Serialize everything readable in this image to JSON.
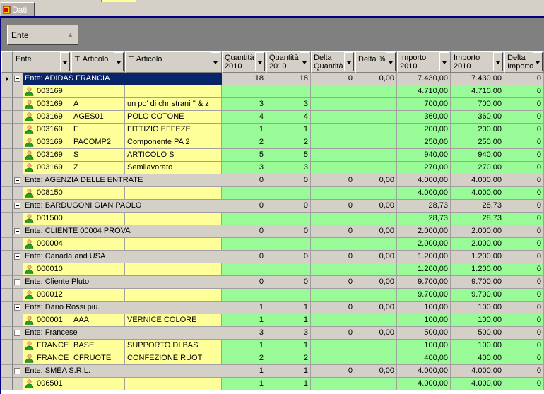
{
  "tab": {
    "label": "Dati"
  },
  "group_panel": {
    "label": "Ente"
  },
  "columns": {
    "ente": "Ente",
    "articolo1": "Articolo",
    "articolo2": "Articolo",
    "q2010a": "Quantità\n2010",
    "q2010b": "Quantità\n2010",
    "delta_q": "Delta\nQuantità",
    "delta_pct": "Delta %",
    "imp2010a": "Importo\n2010",
    "imp2010b": "Importo\n2010",
    "delta_imp": "Delta\nImporto"
  },
  "rows": [
    {
      "type": "group",
      "selected": true,
      "title": "Ente: ADIDAS FRANCIA",
      "v": [
        "18",
        "18",
        "0",
        "0,00",
        "7.430,00",
        "7.430,00",
        "0"
      ]
    },
    {
      "type": "detail",
      "c": [
        "003169",
        "",
        ""
      ],
      "v": [
        "",
        "",
        "",
        "",
        "4.710,00",
        "4.710,00",
        "0"
      ]
    },
    {
      "type": "detail",
      "c": [
        "003169",
        "A",
        "un po' di chr strani '' & z"
      ],
      "v": [
        "3",
        "3",
        "",
        "",
        "700,00",
        "700,00",
        "0"
      ]
    },
    {
      "type": "detail",
      "c": [
        "003169",
        "AGES01",
        "POLO COTONE"
      ],
      "v": [
        "4",
        "4",
        "",
        "",
        "360,00",
        "360,00",
        "0"
      ]
    },
    {
      "type": "detail",
      "c": [
        "003169",
        "F",
        "FITTIZIO EFFEZE"
      ],
      "v": [
        "1",
        "1",
        "",
        "",
        "200,00",
        "200,00",
        "0"
      ]
    },
    {
      "type": "detail",
      "c": [
        "003169",
        "PACOMP2",
        "Componente PA 2"
      ],
      "v": [
        "2",
        "2",
        "",
        "",
        "250,00",
        "250,00",
        "0"
      ]
    },
    {
      "type": "detail",
      "c": [
        "003169",
        "S",
        "ARTICOLO S"
      ],
      "v": [
        "5",
        "5",
        "",
        "",
        "940,00",
        "940,00",
        "0"
      ]
    },
    {
      "type": "detail",
      "c": [
        "003169",
        "Z",
        "Semilavorato"
      ],
      "v": [
        "3",
        "3",
        "",
        "",
        "270,00",
        "270,00",
        "0"
      ]
    },
    {
      "type": "group",
      "title": "Ente: AGENZIA DELLE ENTRATE",
      "v": [
        "0",
        "0",
        "0",
        "0,00",
        "4.000,00",
        "4.000,00",
        "0"
      ]
    },
    {
      "type": "detail",
      "c": [
        "008150",
        "",
        ""
      ],
      "v": [
        "",
        "",
        "",
        "",
        "4.000,00",
        "4.000,00",
        "0"
      ]
    },
    {
      "type": "group",
      "title": "Ente: BARDUGONI GIAN PAOLO",
      "v": [
        "0",
        "0",
        "0",
        "0,00",
        "28,73",
        "28,73",
        "0"
      ]
    },
    {
      "type": "detail",
      "c": [
        "001500",
        "",
        ""
      ],
      "v": [
        "",
        "",
        "",
        "",
        "28,73",
        "28,73",
        "0"
      ]
    },
    {
      "type": "group",
      "title": "Ente: CLIENTE 00004 PROVA",
      "v": [
        "0",
        "0",
        "0",
        "0,00",
        "2.000,00",
        "2.000,00",
        "0"
      ]
    },
    {
      "type": "detail",
      "c": [
        "000004",
        "",
        ""
      ],
      "v": [
        "",
        "",
        "",
        "",
        "2.000,00",
        "2.000,00",
        "0"
      ]
    },
    {
      "type": "group",
      "title": "Ente: Canada and USA",
      "v": [
        "0",
        "0",
        "0",
        "0,00",
        "1.200,00",
        "1.200,00",
        "0"
      ]
    },
    {
      "type": "detail",
      "c": [
        "000010",
        "",
        ""
      ],
      "v": [
        "",
        "",
        "",
        "",
        "1.200,00",
        "1.200,00",
        "0"
      ]
    },
    {
      "type": "group",
      "title": "Ente: Cliente Pluto",
      "v": [
        "0",
        "0",
        "0",
        "0,00",
        "9.700,00",
        "9.700,00",
        "0"
      ]
    },
    {
      "type": "detail",
      "c": [
        "000012",
        "",
        ""
      ],
      "v": [
        "",
        "",
        "",
        "",
        "9.700,00",
        "9.700,00",
        "0"
      ]
    },
    {
      "type": "group",
      "title": "Ente: Dario Rossi piu.",
      "v": [
        "1",
        "1",
        "0",
        "0,00",
        "100,00",
        "100,00",
        "0"
      ]
    },
    {
      "type": "detail",
      "c": [
        "000001",
        "AAA",
        "VERNICE COLORE"
      ],
      "v": [
        "1",
        "1",
        "",
        "",
        "100,00",
        "100,00",
        "0"
      ]
    },
    {
      "type": "group",
      "title": "Ente: Francese",
      "v": [
        "3",
        "3",
        "0",
        "0,00",
        "500,00",
        "500,00",
        "0"
      ]
    },
    {
      "type": "detail",
      "c": [
        "FRANCE",
        "BASE",
        "SUPPORTO DI BAS"
      ],
      "v": [
        "1",
        "1",
        "",
        "",
        "100,00",
        "100,00",
        "0"
      ]
    },
    {
      "type": "detail",
      "c": [
        "FRANCE",
        "CFRUOTE",
        "CONFEZIONE RUOT"
      ],
      "v": [
        "2",
        "2",
        "",
        "",
        "400,00",
        "400,00",
        "0"
      ]
    },
    {
      "type": "group",
      "title": "Ente: SMEA S.R.L.",
      "v": [
        "1",
        "1",
        "0",
        "0,00",
        "4.000,00",
        "4.000,00",
        "0"
      ]
    },
    {
      "type": "detail",
      "c": [
        "006501",
        "",
        ""
      ],
      "v": [
        "1",
        "1",
        "",
        "",
        "4.000,00",
        "4.000,00",
        "0"
      ]
    }
  ]
}
